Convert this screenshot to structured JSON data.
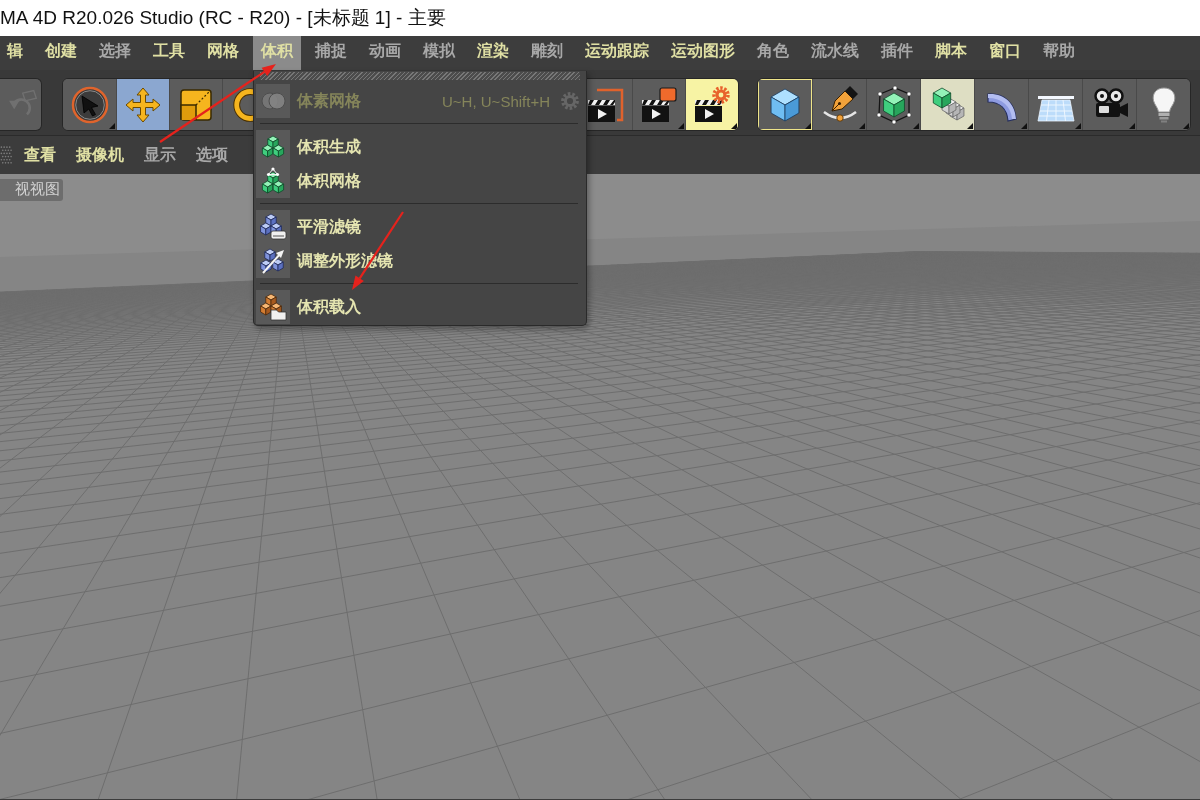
{
  "window": {
    "title": "MA 4D R20.026 Studio (RC - R20) - [未标题 1] - 主要"
  },
  "menu_bar": {
    "items": [
      {
        "label": "辑",
        "highlighted": true,
        "selected": false
      },
      {
        "label": "创建",
        "highlighted": true,
        "selected": false
      },
      {
        "label": "选择",
        "highlighted": false,
        "selected": false
      },
      {
        "label": "工具",
        "highlighted": true,
        "selected": false
      },
      {
        "label": "网格",
        "highlighted": true,
        "selected": false
      },
      {
        "label": "体积",
        "highlighted": true,
        "selected": true
      },
      {
        "label": "捕捉",
        "highlighted": false,
        "selected": false
      },
      {
        "label": "动画",
        "highlighted": false,
        "selected": false
      },
      {
        "label": "模拟",
        "highlighted": false,
        "selected": false
      },
      {
        "label": "渲染",
        "highlighted": true,
        "selected": false
      },
      {
        "label": "雕刻",
        "highlighted": false,
        "selected": false
      },
      {
        "label": "运动跟踪",
        "highlighted": true,
        "selected": false
      },
      {
        "label": "运动图形",
        "highlighted": true,
        "selected": false
      },
      {
        "label": "角色",
        "highlighted": false,
        "selected": false
      },
      {
        "label": "流水线",
        "highlighted": false,
        "selected": false
      },
      {
        "label": "插件",
        "highlighted": false,
        "selected": false
      },
      {
        "label": "脚本",
        "highlighted": true,
        "selected": false
      },
      {
        "label": "窗口",
        "highlighted": true,
        "selected": false
      },
      {
        "label": "帮助",
        "highlighted": false,
        "selected": false
      }
    ]
  },
  "toolbar": {
    "groups": [
      {
        "buttons": [
          {
            "selected": false,
            "disabled": true,
            "highlighted": false,
            "tinted": false,
            "outlined": false,
            "submenu": false
          }
        ]
      },
      {
        "buttons": [
          {
            "selected": false,
            "disabled": false,
            "highlighted": false,
            "tinted": false,
            "outlined": false,
            "submenu": true
          },
          {
            "selected": true,
            "disabled": false,
            "highlighted": false,
            "tinted": false,
            "outlined": false,
            "submenu": false
          },
          {
            "selected": false,
            "disabled": false,
            "highlighted": false,
            "tinted": false,
            "outlined": false,
            "submenu": false
          },
          {
            "selected": false,
            "disabled": false,
            "highlighted": false,
            "tinted": false,
            "outlined": false,
            "submenu": false
          }
        ]
      },
      {
        "buttons": [
          {
            "selected": false,
            "disabled": false,
            "highlighted": false,
            "tinted": false,
            "outlined": false,
            "submenu": false
          },
          {
            "selected": false,
            "disabled": false,
            "highlighted": false,
            "tinted": false,
            "outlined": false,
            "submenu": true
          },
          {
            "selected": false,
            "disabled": false,
            "highlighted": true,
            "tinted": false,
            "outlined": false,
            "submenu": true
          }
        ]
      },
      {
        "buttons": [
          {
            "selected": false,
            "disabled": false,
            "highlighted": false,
            "tinted": false,
            "outlined": true,
            "submenu": true
          },
          {
            "selected": false,
            "disabled": false,
            "highlighted": false,
            "tinted": false,
            "outlined": false,
            "submenu": true
          },
          {
            "selected": false,
            "disabled": false,
            "highlighted": false,
            "tinted": false,
            "outlined": false,
            "submenu": true
          },
          {
            "selected": false,
            "disabled": false,
            "highlighted": false,
            "tinted": true,
            "outlined": false,
            "submenu": true
          },
          {
            "selected": false,
            "disabled": false,
            "highlighted": false,
            "tinted": false,
            "outlined": false,
            "submenu": true
          },
          {
            "selected": false,
            "disabled": false,
            "highlighted": false,
            "tinted": false,
            "outlined": false,
            "submenu": true
          },
          {
            "selected": false,
            "disabled": false,
            "highlighted": false,
            "tinted": false,
            "outlined": false,
            "submenu": true
          },
          {
            "selected": false,
            "disabled": false,
            "highlighted": false,
            "tinted": false,
            "outlined": false,
            "submenu": true
          }
        ]
      }
    ]
  },
  "view_bar": {
    "items": [
      {
        "label": "查看",
        "highlighted": true
      },
      {
        "label": "摄像机",
        "highlighted": true
      },
      {
        "label": "显示",
        "highlighted": false
      },
      {
        "label": "选项",
        "highlighted": false
      }
    ]
  },
  "viewport": {
    "label": "视视图"
  },
  "volume_menu": {
    "groups": [
      {
        "items": [
          {
            "label": "体素网格",
            "shortcut": "U~H, U~Shift+H",
            "disabled": true,
            "options": true
          }
        ]
      },
      {
        "items": [
          {
            "label": "体积生成",
            "disabled": false,
            "options": false
          },
          {
            "label": "体积网格",
            "disabled": false,
            "options": false
          }
        ]
      },
      {
        "items": [
          {
            "label": "平滑滤镜",
            "disabled": false,
            "options": false
          },
          {
            "label": "调整外形滤镜",
            "disabled": false,
            "options": false
          }
        ]
      },
      {
        "items": [
          {
            "label": "体积载入",
            "disabled": false,
            "options": false
          }
        ]
      }
    ]
  },
  "annotations": [
    {
      "kind": "arrow"
    },
    {
      "kind": "arrow"
    }
  ]
}
